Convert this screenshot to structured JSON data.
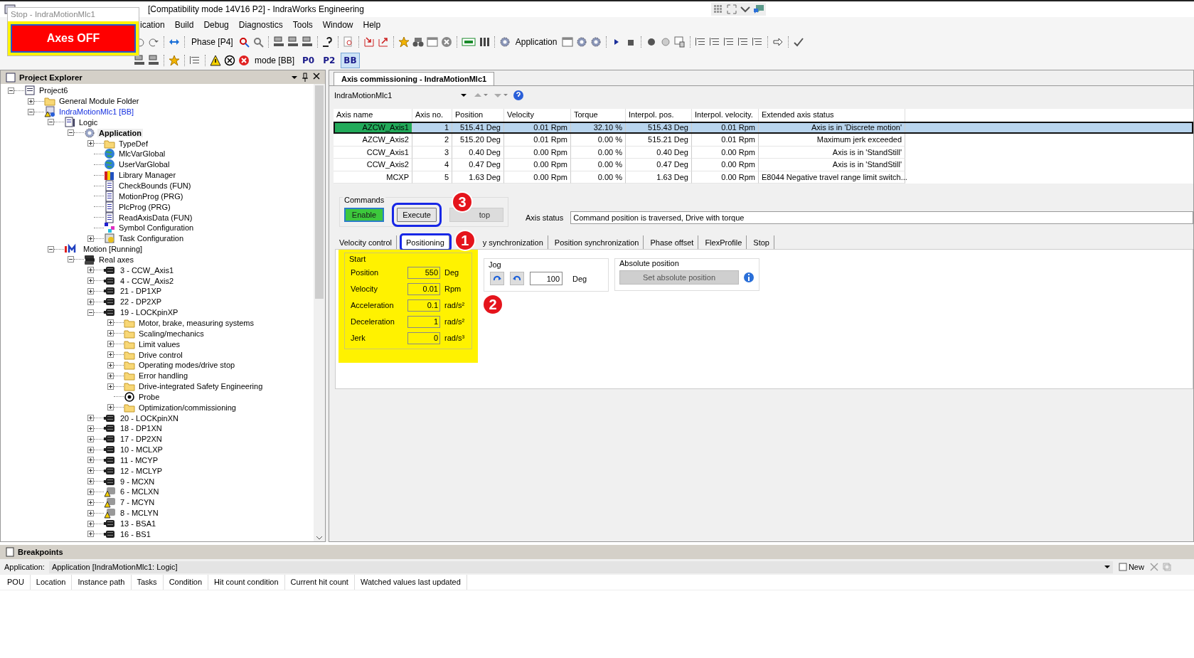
{
  "window": {
    "title": "[Compatibility mode 14V16 P2] - IndraWorks Engineering"
  },
  "stop_dialog": {
    "title": "Stop - IndraMotionMlc1",
    "button": "Axes OFF"
  },
  "menu": [
    "ication",
    "Build",
    "Debug",
    "Diagnostics",
    "Tools",
    "Window",
    "Help"
  ],
  "toolbar": {
    "phase": "Phase [P4]",
    "application": "Application",
    "mode": "mode [BB]",
    "mode_buttons": [
      {
        "label": "P0",
        "selected": false
      },
      {
        "label": "P2",
        "selected": false
      },
      {
        "label": "BB",
        "selected": true
      }
    ]
  },
  "project_explorer": {
    "title": "Project Explorer",
    "tree": [
      {
        "label": "Project6",
        "kind": "project",
        "selected": false,
        "expanded": true,
        "children": [
          {
            "label": "General Module Folder",
            "kind": "folder",
            "selected": false,
            "expanded": false
          },
          {
            "label": "IndraMotionMlc1 [BB]",
            "kind": "device",
            "selected": false,
            "expanded": true,
            "children": [
              {
                "label": "Logic",
                "kind": "logic",
                "selected": false,
                "expanded": true,
                "children": [
                  {
                    "label": "Application",
                    "kind": "gear",
                    "selected": true,
                    "expanded": true,
                    "children": [
                      {
                        "label": "TypeDef",
                        "kind": "folder",
                        "selected": false,
                        "expanded": false
                      },
                      {
                        "label": "MlcVarGlobal",
                        "kind": "globe",
                        "selected": false
                      },
                      {
                        "label": "UserVarGlobal",
                        "kind": "globe",
                        "selected": false
                      },
                      {
                        "label": "Library Manager",
                        "kind": "library",
                        "selected": false
                      },
                      {
                        "label": "CheckBounds (FUN)",
                        "kind": "doc",
                        "selected": false
                      },
                      {
                        "label": "MotionProg (PRG)",
                        "kind": "doc",
                        "selected": false
                      },
                      {
                        "label": "PlcProg (PRG)",
                        "kind": "doc",
                        "selected": false
                      },
                      {
                        "label": "ReadAxisData (FUN)",
                        "kind": "doc",
                        "selected": false
                      },
                      {
                        "label": "Symbol Configuration",
                        "kind": "symbol",
                        "selected": false
                      },
                      {
                        "label": "Task Configuration",
                        "kind": "task",
                        "selected": false,
                        "expanded": false
                      }
                    ]
                  }
                ]
              },
              {
                "label": "Motion [Running]",
                "kind": "motion",
                "selected": false,
                "expanded": true,
                "children": [
                  {
                    "label": "Real axes",
                    "kind": "axes",
                    "selected": false,
                    "expanded": true,
                    "children": [
                      {
                        "label": "3 - CCW_Axis1",
                        "kind": "axis",
                        "selected": false,
                        "expanded": false
                      },
                      {
                        "label": "4 - CCW_Axis2",
                        "kind": "axis",
                        "selected": false,
                        "expanded": false
                      },
                      {
                        "label": "21 - DP1XP",
                        "kind": "axis",
                        "selected": false,
                        "expanded": false
                      },
                      {
                        "label": "22 - DP2XP",
                        "kind": "axis",
                        "selected": false,
                        "expanded": false
                      },
                      {
                        "label": "19 - LOCKpinXP",
                        "kind": "axis",
                        "selected": false,
                        "expanded": true,
                        "children": [
                          {
                            "label": "Motor, brake, measuring systems",
                            "kind": "folder",
                            "selected": false,
                            "expanded": false
                          },
                          {
                            "label": "Scaling/mechanics",
                            "kind": "folder",
                            "selected": false,
                            "expanded": false
                          },
                          {
                            "label": "Limit values",
                            "kind": "folder",
                            "selected": false,
                            "expanded": false
                          },
                          {
                            "label": "Drive control",
                            "kind": "folder",
                            "selected": false,
                            "expanded": false
                          },
                          {
                            "label": "Operating modes/drive stop",
                            "kind": "folder",
                            "selected": false,
                            "expanded": false
                          },
                          {
                            "label": "Error handling",
                            "kind": "folder",
                            "selected": false,
                            "expanded": false
                          },
                          {
                            "label": "Drive-integrated Safety Engineering",
                            "kind": "folder",
                            "selected": false,
                            "expanded": false
                          },
                          {
                            "label": "Probe",
                            "kind": "probe",
                            "selected": false
                          },
                          {
                            "label": "Optimization/commissioning",
                            "kind": "folder",
                            "selected": false,
                            "expanded": false
                          }
                        ]
                      },
                      {
                        "label": "20 - LOCKpinXN",
                        "kind": "axis",
                        "selected": false,
                        "expanded": false
                      },
                      {
                        "label": "18 - DP1XN",
                        "kind": "axis",
                        "selected": false,
                        "expanded": false
                      },
                      {
                        "label": "17 - DP2XN",
                        "kind": "axis",
                        "selected": false,
                        "expanded": false
                      },
                      {
                        "label": "10 - MCLXP",
                        "kind": "axis",
                        "selected": false,
                        "expanded": false
                      },
                      {
                        "label": "11 - MCYP",
                        "kind": "axis",
                        "selected": false,
                        "expanded": false
                      },
                      {
                        "label": "12 - MCLYP",
                        "kind": "axis",
                        "selected": false,
                        "expanded": false
                      },
                      {
                        "label": "9 - MCXN",
                        "kind": "axis",
                        "selected": false,
                        "expanded": false
                      },
                      {
                        "label": "6 - MCLXN",
                        "kind": "axis-warn",
                        "selected": false,
                        "expanded": false
                      },
                      {
                        "label": "7 - MCYN",
                        "kind": "axis-warn",
                        "selected": false,
                        "expanded": false
                      },
                      {
                        "label": "8 - MCLYN",
                        "kind": "axis-warn",
                        "selected": false,
                        "expanded": false
                      },
                      {
                        "label": "13 - BSA1",
                        "kind": "axis",
                        "selected": false,
                        "expanded": false
                      },
                      {
                        "label": "16 - BS1",
                        "kind": "axis",
                        "selected": false,
                        "expanded": false
                      }
                    ]
                  }
                ]
              }
            ]
          }
        ]
      }
    ]
  },
  "editor": {
    "tab": "Axis commissioning - IndraMotionMlc1",
    "device": "IndraMotionMlc1",
    "table": {
      "columns": [
        "Axis name",
        "Axis no.",
        "Position",
        "Velocity",
        "Torque",
        "Interpol. pos.",
        "Interpol. velocity.",
        "Extended axis status"
      ],
      "rows": [
        {
          "selected": true,
          "cells": [
            "AZCW_Axis1",
            "1",
            "515.41 Deg",
            "0.01 Rpm",
            "32.10 %",
            "515.43 Deg",
            "0.01 Rpm",
            "Axis is in 'Discrete motion'"
          ]
        },
        {
          "selected": false,
          "cells": [
            "AZCW_Axis2",
            "2",
            "515.20 Deg",
            "0.01 Rpm",
            "0.00 %",
            "515.21 Deg",
            "0.01 Rpm",
            "Maximum jerk exceeded"
          ]
        },
        {
          "selected": false,
          "cells": [
            "CCW_Axis1",
            "3",
            "0.40 Deg",
            "0.00 Rpm",
            "0.00 %",
            "0.40 Deg",
            "0.00 Rpm",
            "Axis is in 'StandStill'"
          ]
        },
        {
          "selected": false,
          "cells": [
            "CCW_Axis2",
            "4",
            "0.47 Deg",
            "0.00 Rpm",
            "0.00 %",
            "0.47 Deg",
            "0.00 Rpm",
            "Axis is in 'StandStill'"
          ]
        },
        {
          "selected": false,
          "cells": [
            "MCXP",
            "5",
            "1.63 Deg",
            "0.00 Rpm",
            "0.00 %",
            "1.63 Deg",
            "0.00 Rpm",
            "E8044 Negative travel range limit switch..."
          ]
        }
      ]
    },
    "commands": {
      "title": "Commands",
      "buttons": [
        {
          "label": "Enable",
          "kind": "enable",
          "outlined": false
        },
        {
          "label": "Execute",
          "kind": "normal",
          "outlined": true,
          "callout": "3"
        },
        {
          "label": "top",
          "kind": "disabled",
          "outlined": false
        }
      ]
    },
    "axis_status": {
      "label": "Axis status",
      "value": "Command position is traversed, Drive with torque"
    },
    "tabs": [
      {
        "label": "Velocity control",
        "selected": false,
        "outlined": false
      },
      {
        "label": "Positioning",
        "selected": true,
        "outlined": true,
        "callout": "1"
      },
      {
        "label": "y synchronization",
        "selected": false,
        "outlined": false
      },
      {
        "label": "Position synchronization",
        "selected": false,
        "outlined": false
      },
      {
        "label": "Phase offset",
        "selected": false,
        "outlined": false
      },
      {
        "label": "FlexProfile",
        "selected": false,
        "outlined": false
      },
      {
        "label": "Stop",
        "selected": false,
        "outlined": false
      }
    ],
    "start": {
      "title": "Start",
      "highlighted": true,
      "callout": "2",
      "fields": [
        {
          "label": "Position",
          "value": "550",
          "unit": "Deg"
        },
        {
          "label": "Velocity",
          "value": "0.01",
          "unit": "Rpm"
        },
        {
          "label": "Acceleration",
          "value": "0.1",
          "unit": "rad/s²"
        },
        {
          "label": "Deceleration",
          "value": "1",
          "unit": "rad/s²"
        },
        {
          "label": "Jerk",
          "value": "0",
          "unit": "rad/s³"
        }
      ]
    },
    "jog": {
      "title": "Jog",
      "value": "100",
      "unit": "Deg"
    },
    "absolute_position": {
      "title": "Absolute position",
      "button": "Set absolute position",
      "disabled": true
    }
  },
  "breakpoints": {
    "title": "Breakpoints",
    "application_label": "Application:",
    "application": "Application [IndraMotionMlc1: Logic]",
    "new": "New",
    "columns": [
      "POU",
      "Location",
      "Instance path",
      "Tasks",
      "Condition",
      "Hit count condition",
      "Current hit count",
      "Watched values last updated"
    ]
  }
}
